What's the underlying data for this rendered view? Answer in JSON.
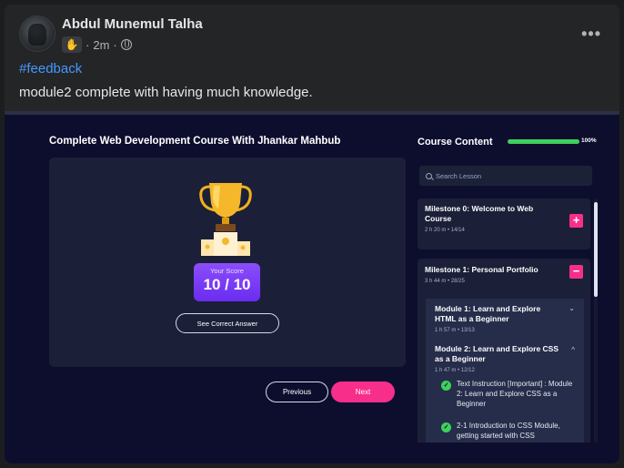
{
  "post": {
    "author": "Abdul Munemul Talha",
    "time": "2m",
    "separator": "·",
    "more_icon": "•••",
    "hashtag": "#feedback",
    "text": "module2 complete with having much knowledge."
  },
  "course": {
    "title": "Complete Web Development Course With Jhankar Mahbub",
    "score_label": "Your Score",
    "score_value": "10 / 10",
    "see_answer": "See Correct Answer",
    "prev": "Previous",
    "next": "Next"
  },
  "content": {
    "title": "Course Content",
    "progress": 1.0,
    "progress_label": "100%",
    "search_placeholder": "Search Lesson",
    "milestones": [
      {
        "title": "Milestone 0: Welcome to Web Course",
        "duration": "2 h 20 m",
        "count": "14/14",
        "toggle": "+"
      },
      {
        "title": "Milestone 1: Personal Portfolio",
        "duration": "3 h 44 m",
        "count": "28/25",
        "toggle": "−"
      }
    ],
    "modules": [
      {
        "title": "Module 1: Learn and Explore HTML as a Beginner",
        "duration": "1 h 57 m",
        "count": "13/13",
        "chevron": "⌄"
      },
      {
        "title": "Module 2: Learn and Explore CSS as a Beginner",
        "duration": "1 h 47 m",
        "count": "12/12",
        "chevron": "^"
      }
    ],
    "lessons": [
      {
        "title": "Text Instruction [Important] : Module 2: Learn and Explore CSS as a Beginner"
      },
      {
        "title": "2-1 Introduction to CSS Module, getting started with CSS"
      }
    ]
  },
  "colors": {
    "accent_pink": "#f72f8a",
    "progress_green": "#3ed15c",
    "link_blue": "#4599ff",
    "score_purple": "#7a3cf6"
  }
}
